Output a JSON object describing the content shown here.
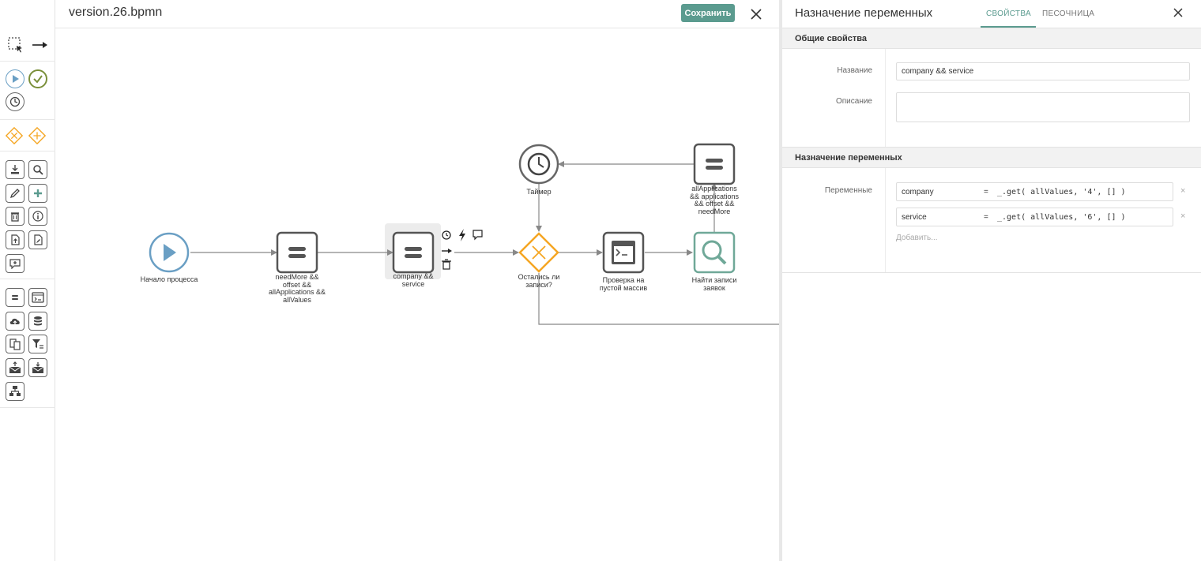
{
  "canvas_header": {
    "file_title": "version.26.bpmn",
    "save_label": "Сохранить"
  },
  "diagram": {
    "nodes": {
      "start": "Начало процесса",
      "task1": "needMore &&\noffset &&\nallApplications &&\nallValues",
      "task2": "company &&\nservice",
      "gateway": "Остались ли\nзаписи?",
      "timer": "Таймер",
      "task3": "allApplications\n&& applications\n&& offset &&\nneedMore",
      "script": "Проверка на\nпустой массив",
      "search": "Найти записи\nзаявок"
    }
  },
  "panel": {
    "title": "Назначение переменных",
    "tabs": [
      "СВОЙСТВА",
      "ПЕСОЧНИЦА"
    ],
    "general_section": "Общие свойства",
    "name_label": "Название",
    "name_value": "company && service",
    "description_label": "Описание",
    "description_value": "",
    "vars_section": "Назначение переменных",
    "vars_label": "Переменные",
    "variables": [
      {
        "name": "company",
        "eq": "=",
        "expr": "_.get( allValues, '4', [] )",
        "remove": "×"
      },
      {
        "name": "service",
        "eq": "=",
        "expr": "_.get( allValues, '6', [] )",
        "remove": "×"
      }
    ],
    "add_label": "Добавить..."
  },
  "colors": {
    "accent": "#5b9b8f",
    "start_event": "#6a9fc4",
    "gateway": "#f5a623",
    "search_task": "#6fa898"
  }
}
